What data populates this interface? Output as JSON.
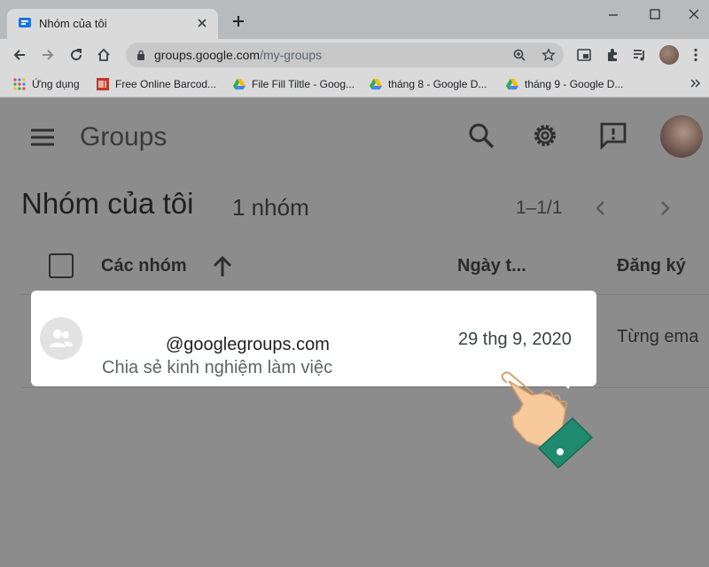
{
  "browser": {
    "tab_title": "Nhóm của tôi",
    "url_host": "groups.google.com",
    "url_path": "/my-groups"
  },
  "bookmarks": [
    {
      "label": "Ứng dụng",
      "icon": "apps-grid-icon"
    },
    {
      "label": "Free Online Barcod...",
      "icon": "barcode-icon"
    },
    {
      "label": "File Fill Tiltle - Goog...",
      "icon": "google-drive-icon"
    },
    {
      "label": "tháng 8 - Google D...",
      "icon": "google-drive-icon"
    },
    {
      "label": "tháng 9 - Google D...",
      "icon": "google-drive-icon"
    }
  ],
  "header": {
    "app_name": "Groups"
  },
  "main": {
    "title": "Nhóm của tôi",
    "count": "1 nhóm",
    "pagination": "1–1/1"
  },
  "table": {
    "columns": {
      "groups": "Các nhóm",
      "date": "Ngày t...",
      "subscription": "Đăng ký"
    },
    "rows": [
      {
        "email": "@googlegroups.com",
        "description": "Chia sẻ kinh nghiệm làm việc",
        "date": "29 thg 9, 2020",
        "subscription": "Từng ema"
      }
    ]
  },
  "colors": {
    "overlay": "#8c8c8c",
    "highlight": "#ffffff",
    "hand_cuff": "#1f8a6e",
    "hand_skin": "#f7c99b"
  }
}
